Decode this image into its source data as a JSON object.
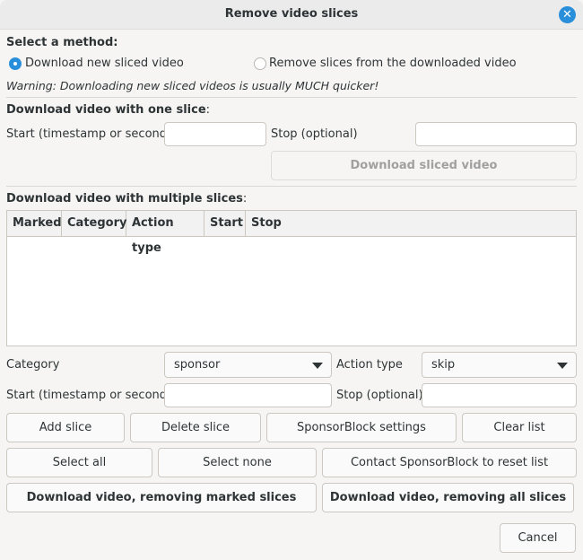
{
  "window": {
    "title": "Remove video slices",
    "close_icon": "close-icon"
  },
  "method": {
    "heading": "Select a method:",
    "options": [
      {
        "label": "Download new sliced video",
        "selected": true
      },
      {
        "label": "Remove slices from the downloaded video",
        "selected": false
      }
    ],
    "warning": "Warning: Downloading new sliced videos is usually MUCH quicker!"
  },
  "one_slice": {
    "heading": "Download video with one slice",
    "heading_suffix": ":",
    "start_label": "Start (timestamp or seconds)",
    "start_value": "",
    "stop_label": "Stop (optional)",
    "stop_value": "",
    "download_button": "Download sliced video"
  },
  "multi_slice": {
    "heading": "Download video with multiple slices",
    "heading_suffix": ":",
    "table": {
      "columns": [
        "Marked",
        "Category",
        "Action type",
        "Start",
        "Stop"
      ],
      "rows": []
    },
    "category_label": "Category",
    "category_value": "sponsor",
    "action_label": "Action type",
    "action_value": "skip",
    "start_label": "Start (timestamp or seconds)",
    "start_value": "",
    "stop_label": "Stop (optional)",
    "stop_value": "",
    "buttons": {
      "add": "Add slice",
      "delete": "Delete slice",
      "sponsorblock_settings": "SponsorBlock settings",
      "clear": "Clear list",
      "select_all": "Select all",
      "select_none": "Select none",
      "contact": "Contact SponsorBlock to reset list",
      "download_marked": "Download video, removing marked slices",
      "download_all": "Download video, removing all slices"
    }
  },
  "footer": {
    "cancel": "Cancel"
  }
}
